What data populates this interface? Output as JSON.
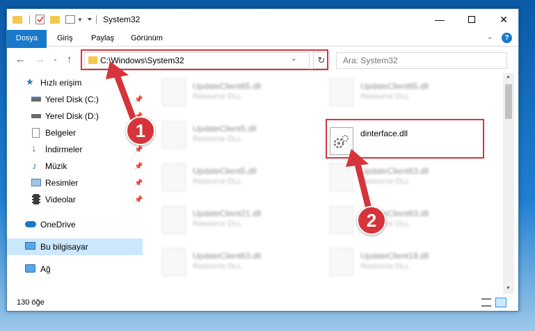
{
  "window": {
    "title": "System32"
  },
  "ribbon": {
    "tabs": [
      "Dosya",
      "Giriş",
      "Paylaş",
      "Görünüm"
    ]
  },
  "address": {
    "path": "C:\\Windows\\System32"
  },
  "search": {
    "placeholder": "Ara: System32"
  },
  "sidebar": {
    "items": [
      {
        "label": "Hızlı erişim",
        "icon": "star-icon"
      },
      {
        "label": "Yerel Disk (C:)",
        "icon": "drive-icon"
      },
      {
        "label": "Yerel Disk (D:)",
        "icon": "drive-icon"
      },
      {
        "label": "Belgeler",
        "icon": "document-icon"
      },
      {
        "label": "İndirmeler",
        "icon": "download-icon"
      },
      {
        "label": "Müzik",
        "icon": "music-icon"
      },
      {
        "label": "Resimler",
        "icon": "pictures-icon"
      },
      {
        "label": "Videolar",
        "icon": "video-icon"
      },
      {
        "label": "OneDrive",
        "icon": "cloud-icon"
      },
      {
        "label": "Bu bilgisayar",
        "icon": "computer-icon"
      },
      {
        "label": "Ağ",
        "icon": "network-icon"
      }
    ]
  },
  "files": {
    "left": [
      {
        "name": "UpdateClient65.dll",
        "type": "Resource DLL"
      },
      {
        "name": "UpdateClient5.dll",
        "type": "Resource DLL"
      },
      {
        "name": "UpdateClient5.dll",
        "type": "Resource DLL"
      },
      {
        "name": "UpdateClient21.dll",
        "type": "Resource DLL"
      },
      {
        "name": "UpdateClient63.dll",
        "type": "Resource DLL"
      }
    ],
    "right": [
      {
        "name": "UpdateClient65.dll",
        "type": "Resource DLL"
      },
      {
        "name": "dinterface.dll",
        "type": ""
      },
      {
        "name": "UpdateClient63.dll",
        "type": "Resource DLL"
      },
      {
        "name": "UpdateClient63.dll",
        "type": "Resource DLL"
      },
      {
        "name": "UpdateClient19.dll",
        "type": "Resource DLL"
      }
    ]
  },
  "status": {
    "count": "130 öğe"
  },
  "badges": {
    "one": "1",
    "two": "2"
  },
  "colors": {
    "accent": "#1979ca",
    "highlight": "#d6343b",
    "selected": "#cce8ff"
  }
}
